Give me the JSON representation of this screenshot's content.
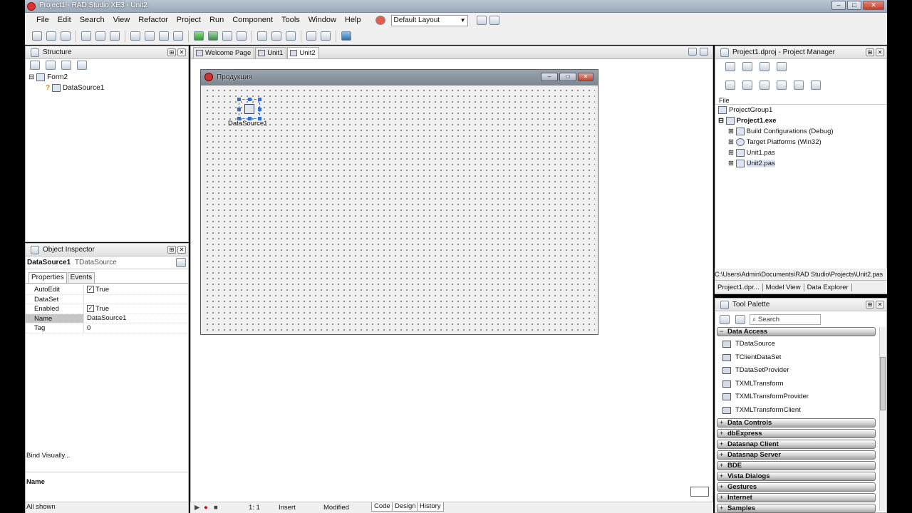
{
  "window": {
    "title": "Project1 - RAD Studio XE3 - Unit2"
  },
  "menu": [
    "File",
    "Edit",
    "Search",
    "View",
    "Refactor",
    "Project",
    "Run",
    "Component",
    "Tools",
    "Window",
    "Help"
  ],
  "layout_select": "Default Layout",
  "structure": {
    "title": "Structure",
    "tree": [
      "Form2",
      "DataSource1"
    ]
  },
  "object_inspector": {
    "title": "Object Inspector",
    "selected_name": "DataSource1",
    "selected_type": "TDataSource",
    "tabs": [
      "Properties",
      "Events"
    ],
    "props": [
      {
        "name": "AutoEdit",
        "value": "True",
        "checkbox": true
      },
      {
        "name": "DataSet",
        "value": "",
        "checkbox": false
      },
      {
        "name": "Enabled",
        "value": "True",
        "checkbox": true
      },
      {
        "name": "Name",
        "value": "DataSource1",
        "checkbox": false,
        "selected": true
      },
      {
        "name": "Tag",
        "value": "0",
        "checkbox": false
      }
    ],
    "bind_visually": "Bind Visually...",
    "desc_title": "Name",
    "status": "All shown"
  },
  "editor": {
    "tabs": [
      "Welcome Page",
      "Unit1",
      "Unit2"
    ],
    "form_caption": "Продукция",
    "component_label": "DataSource1"
  },
  "statusbar": {
    "position": "1:  1",
    "mode": "Insert",
    "state": "Modified",
    "tabs": [
      "Code",
      "Design",
      "History"
    ]
  },
  "project_manager": {
    "title": "Project1.dproj - Project Manager",
    "file_col": "File",
    "tree": [
      {
        "label": "ProjectGroup1",
        "bold": false
      },
      {
        "label": "Project1.exe",
        "bold": true
      },
      {
        "label": "Build Configurations (Debug)",
        "bold": false
      },
      {
        "label": "Target Platforms (Win32)",
        "bold": false
      },
      {
        "label": "Unit1.pas",
        "bold": false
      },
      {
        "label": "Unit2.pas",
        "bold": false
      }
    ],
    "path": "C:\\Users\\Admin\\Documents\\RAD Studio\\Projects\\Unit2.pas",
    "tabs": [
      "Project1.dpr...",
      "Model View",
      "Data Explorer"
    ]
  },
  "tool_palette": {
    "title": "Tool Palette",
    "search_placeholder": "Search",
    "open_category": "Data Access",
    "items": [
      "TDataSource",
      "TClientDataSet",
      "TDataSetProvider",
      "TXMLTransform",
      "TXMLTransformProvider",
      "TXMLTransformClient"
    ],
    "categories": [
      "Data Controls",
      "dbExpress",
      "Datasnap Client",
      "Datasnap Server",
      "BDE",
      "Vista Dialogs",
      "Gestures",
      "Internet",
      "Samples"
    ]
  }
}
